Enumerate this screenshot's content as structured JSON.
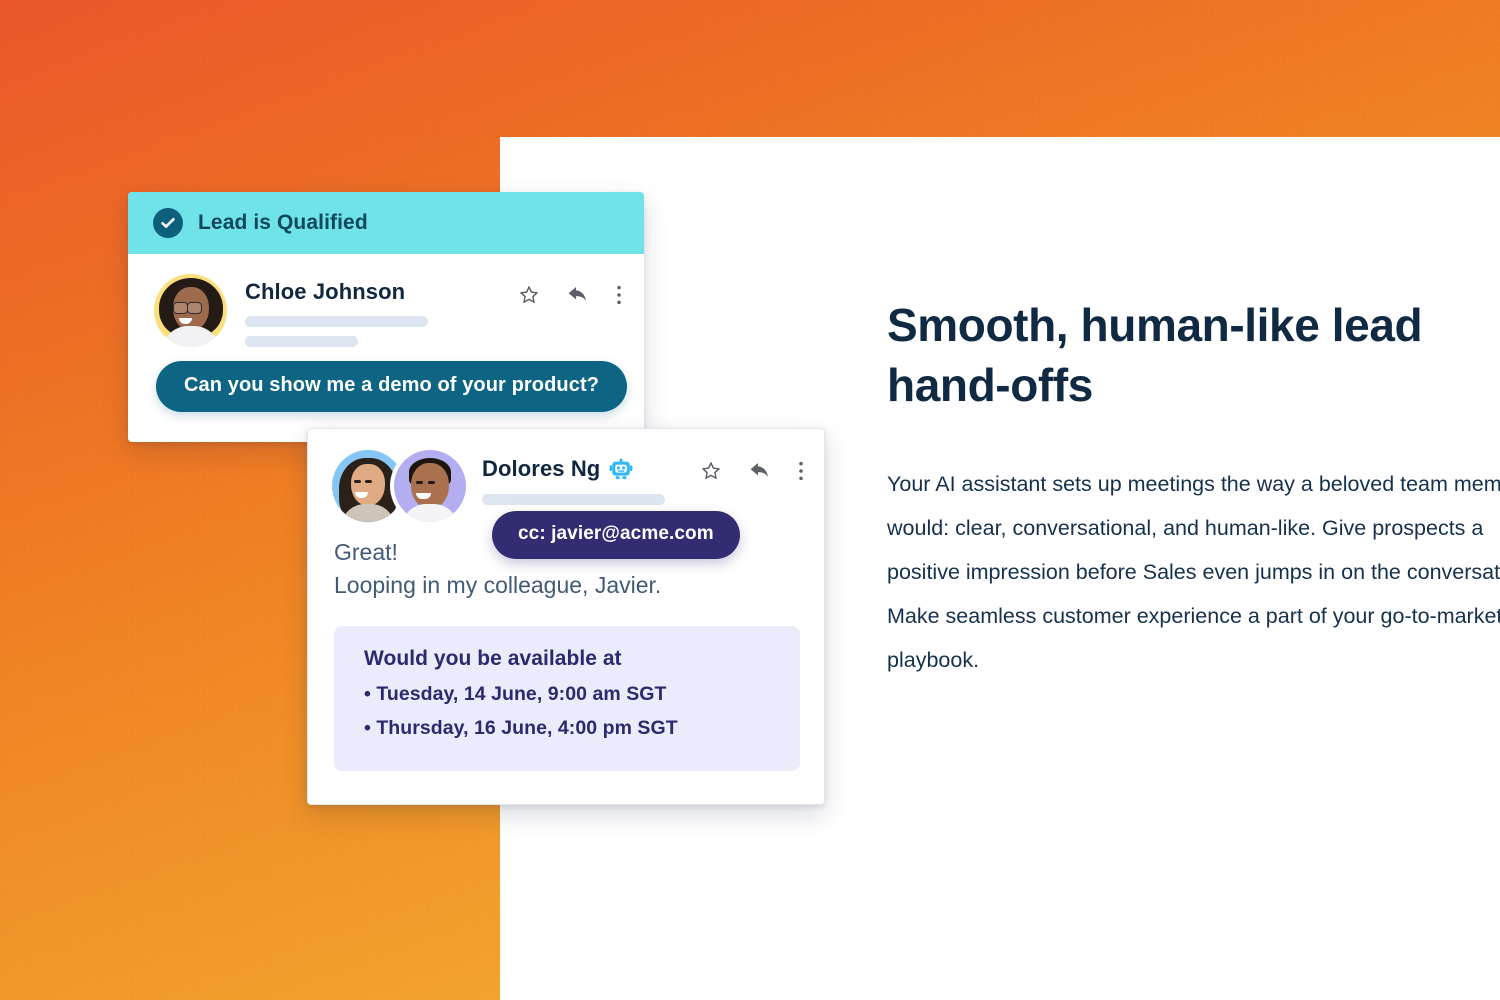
{
  "background": {
    "gradient_from": "#e8562a",
    "gradient_to": "#f5b431",
    "panel_color": "#ffffff"
  },
  "copy": {
    "heading": "Smooth, human-like lead\nhand-offs",
    "body": "Your AI assistant sets up meetings the way a beloved team member would: clear, conversational, and human-like. Give prospects a positive impression before Sales even jumps in on the conversation. Make seamless customer experience a part of your go-to-market playbook.",
    "heading_color": "#102a43",
    "body_color": "#15314d"
  },
  "card_lead": {
    "banner": {
      "label": "Lead is Qualified",
      "icon": "check-circle-icon",
      "background": "#6fe3e8",
      "text_color": "#10465e",
      "badge_color": "#0d5f7c"
    },
    "sender": {
      "name": "Chloe Johnson",
      "avatar": "chloe-johnson-avatar",
      "avatar_background": "#fbdf7d"
    },
    "actions": [
      {
        "name": "star-icon",
        "label": "Star"
      },
      {
        "name": "reply-icon",
        "label": "Reply"
      },
      {
        "name": "more-vertical-icon",
        "label": "More"
      }
    ],
    "message": {
      "text": "Can you show me a demo of your product?",
      "background": "#0d6583",
      "text_color": "#ffffff"
    }
  },
  "card_dolores": {
    "sender": {
      "name": "Dolores Ng",
      "badge_icon": "robot-icon",
      "avatars": [
        {
          "name": "dolores-ng-avatar",
          "background": "#85c6f5"
        },
        {
          "name": "javier-avatar",
          "background": "#b2aef0"
        }
      ]
    },
    "actions": [
      {
        "name": "star-icon",
        "label": "Star"
      },
      {
        "name": "reply-icon",
        "label": "Reply"
      },
      {
        "name": "more-vertical-icon",
        "label": "More"
      }
    ],
    "cc_pill": {
      "text": "cc: javier@acme.com",
      "background": "#322d73",
      "text_color": "#ffffff"
    },
    "body_line_1": "Great!",
    "body_line_2": "Looping in my colleague, Javier.",
    "body_color": "#415a77",
    "availability": {
      "title": "Would you be available at",
      "options": [
        "• Tuesday, 14 June, 9:00 am SGT",
        "• Thursday, 16 June, 4:00 pm SGT"
      ],
      "background": "#eaebfb",
      "text_color": "#2b2a6e"
    }
  }
}
